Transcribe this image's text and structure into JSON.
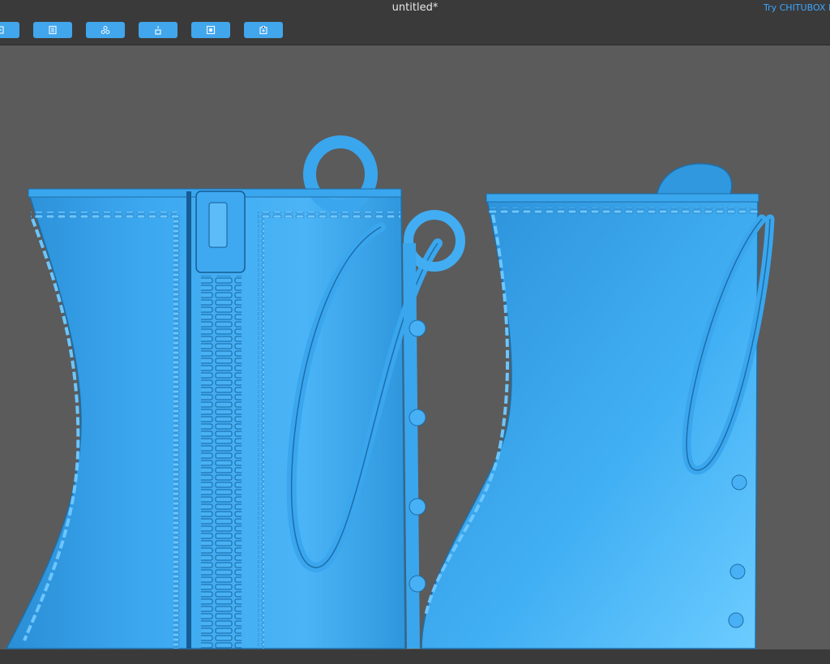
{
  "window": {
    "title": "untitled*",
    "promo": "Try CHITUBOX Pro"
  },
  "toolbar": {
    "buttons": [
      {
        "name": "import-button",
        "icon": "import-icon"
      },
      {
        "name": "layers-button",
        "icon": "layers-icon"
      },
      {
        "name": "arrange-button",
        "icon": "arrange-icon"
      },
      {
        "name": "support-button",
        "icon": "support-icon"
      },
      {
        "name": "hollow-button",
        "icon": "hollow-icon"
      },
      {
        "name": "slice-button",
        "icon": "slice-icon"
      }
    ]
  },
  "viewport": {
    "model_color": "#3da8f0",
    "background": "#5b5b5b",
    "models": [
      "boot-left",
      "boot-right"
    ]
  }
}
